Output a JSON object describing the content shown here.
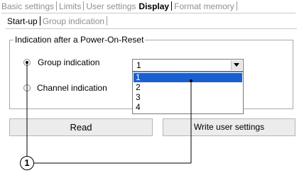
{
  "top_tabs": [
    {
      "label": "Basic settings"
    },
    {
      "label": "Limits"
    },
    {
      "label": "User settings"
    },
    {
      "label": "Display"
    },
    {
      "label": "Format memory"
    }
  ],
  "active_top_tab": "Display",
  "sub_tabs": [
    {
      "label": "Start-up"
    },
    {
      "label": "Group indication"
    }
  ],
  "active_sub_tab": "Start-up",
  "groupbox": {
    "title": "Indication after a Power-On-Reset",
    "radio_group_label": "Group indication",
    "radio_channel_label": "Channel indication",
    "selected_radio": "Group indication"
  },
  "combo": {
    "value": "1",
    "options": [
      "1",
      "2",
      "3",
      "4"
    ],
    "highlighted_option": "1"
  },
  "buttons": {
    "read": "Read",
    "write": "Write user settings"
  },
  "callout": {
    "number": "1"
  },
  "colors": {
    "selection": "#1a5fcf",
    "inactive_tab_text": "#8f8f8f"
  }
}
